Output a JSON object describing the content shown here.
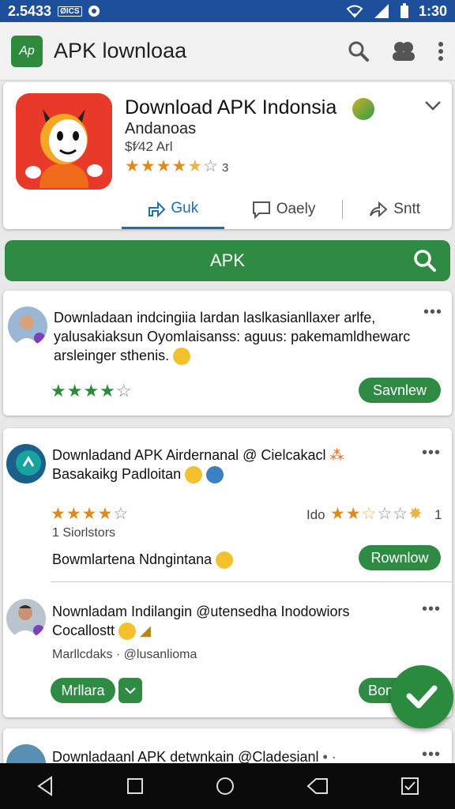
{
  "status_bar": {
    "time_left": "2.5433",
    "carrier": "ØICS",
    "clock": "1:30"
  },
  "app_bar": {
    "logo_text": "Ap",
    "title": "APK lownloaa",
    "icons": [
      "search-icon",
      "account-icon",
      "more-vert-icon"
    ]
  },
  "app_card": {
    "name": "Download APK Indonsia",
    "developer": "Andanoas",
    "price": "$f⁄42 Arl",
    "rating_stars": 4.5,
    "rating_count": "3",
    "tabs": [
      {
        "label": "Guk",
        "icon": "share-arrow-icon",
        "active": true
      },
      {
        "label": "Oaely",
        "icon": "comment-icon",
        "active": false
      },
      {
        "label": "Sntt",
        "icon": "forward-icon",
        "active": false
      }
    ]
  },
  "search_bar": {
    "label": "APK"
  },
  "posts": [
    {
      "text_line1": "Downladaan indcingiia lardan laslkasianllaxer arlfe,",
      "text_line2": "yalusakiaksun Oyomlaisanss: aguus: pakemamldhewarc",
      "text_line3": "arsleinger sthenis.",
      "rating": 4,
      "button": "Savnlew"
    },
    {
      "text_line1": "Downladand APK Airdernanal @ Cielcakacl",
      "text_line2": "Basakaikg Padloitan",
      "rating": 4,
      "right_label": "Ido",
      "right_rating": 3,
      "right_count": "1",
      "sub": "1 Siorlstors",
      "line": "Bowmlartena Ndngintana",
      "button": "Rownlow"
    },
    {
      "text_line1": "Nownladam Indilangin @utensedha Inodowiors",
      "text_line2": "Cocallostt",
      "sub": "Marllcdaks · @lusanlioma",
      "button_left": "Mrllara",
      "button_right": "Bon"
    },
    {
      "text_line1": "Downladaanl APK detwnkain @Cladesianl"
    }
  ],
  "colors": {
    "status_bar": "#1d4f9a",
    "brand_green": "#2f8a43",
    "star_orange": "#e08a1e",
    "tab_active": "#1d6fb0"
  }
}
